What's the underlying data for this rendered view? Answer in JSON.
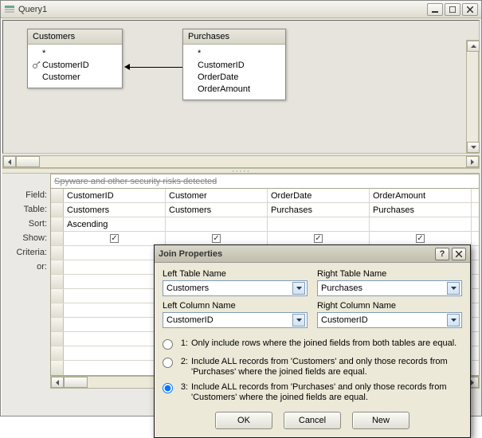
{
  "window": {
    "title": "Query1"
  },
  "tables": {
    "left": {
      "title": "Customers",
      "star": "*",
      "fields": [
        "CustomerID",
        "Customer"
      ],
      "key_field": "CustomerID"
    },
    "right": {
      "title": "Purchases",
      "star": "*",
      "fields": [
        "CustomerID",
        "OrderDate",
        "OrderAmount"
      ]
    }
  },
  "banner": "Spyware and other security risks detected",
  "grid": {
    "labels": {
      "field": "Field:",
      "table": "Table:",
      "sort": "Sort:",
      "show": "Show:",
      "criteria": "Criteria:",
      "or": "or:"
    },
    "cols": [
      {
        "field": "CustomerID",
        "table": "Customers",
        "sort": "Ascending",
        "show": true
      },
      {
        "field": "Customer",
        "table": "Customers",
        "sort": "",
        "show": true
      },
      {
        "field": "OrderDate",
        "table": "Purchases",
        "sort": "",
        "show": true
      },
      {
        "field": "OrderAmount",
        "table": "Purchases",
        "sort": "",
        "show": true
      }
    ]
  },
  "dialog": {
    "title": "Join Properties",
    "left_table_label": "Left Table Name",
    "right_table_label": "Right Table Name",
    "left_col_label": "Left Column Name",
    "right_col_label": "Right Column Name",
    "left_table": "Customers",
    "right_table": "Purchases",
    "left_col": "CustomerID",
    "right_col": "CustomerID",
    "opt1_num": "1:",
    "opt2_num": "2:",
    "opt3_num": "3:",
    "opt1": "Only include rows where the joined fields from both tables are equal.",
    "opt2": "Include ALL records from 'Customers' and only those records from 'Purchases' where the joined fields are equal.",
    "opt3": "Include ALL records from 'Purchases' and only those records from 'Customers' where the joined fields are equal.",
    "selected": 3,
    "ok": "OK",
    "cancel": "Cancel",
    "new": "New"
  }
}
